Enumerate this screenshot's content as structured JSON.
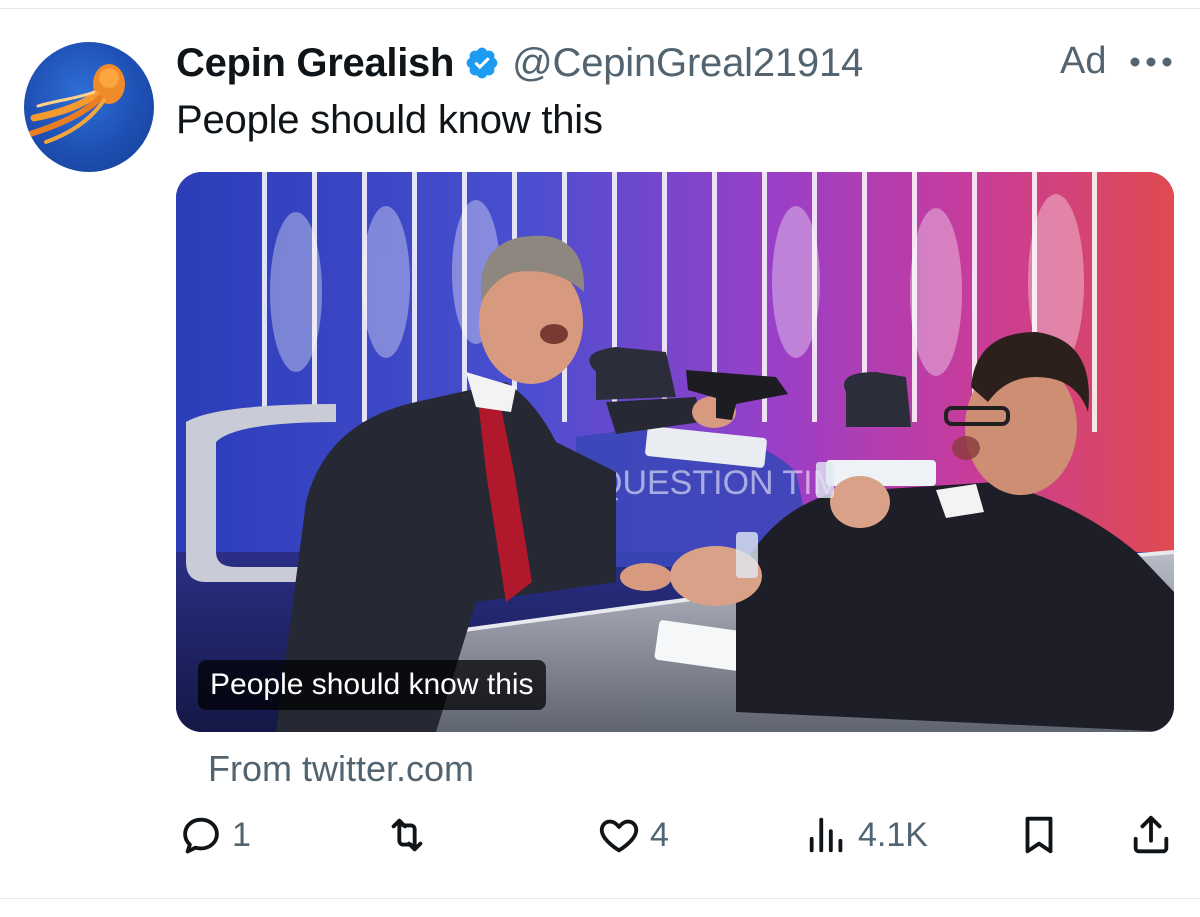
{
  "tweet": {
    "display_name": "Cepin Grealish",
    "handle": "@CepinGreal21914",
    "verified": true,
    "ad_label": "Ad",
    "text": "People should know this",
    "media": {
      "caption": "People should know this",
      "studio_signage": "QUESTION TIM"
    },
    "source": "From twitter.com"
  },
  "actions": {
    "reply": {
      "icon": "reply-icon",
      "count": "1"
    },
    "retweet": {
      "icon": "retweet-icon",
      "count": ""
    },
    "like": {
      "icon": "heart-icon",
      "count": "4"
    },
    "views": {
      "icon": "views-icon",
      "count": "4.1K"
    },
    "bookmark": {
      "icon": "bookmark-icon"
    },
    "share": {
      "icon": "share-icon"
    }
  },
  "colors": {
    "text_primary": "#0f1419",
    "text_secondary": "#536471",
    "verified_blue": "#1d9bf0",
    "divider": "#e6e9ec"
  }
}
